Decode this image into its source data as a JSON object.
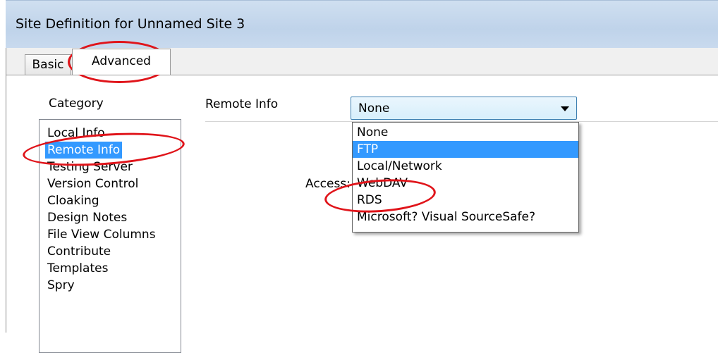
{
  "window": {
    "title": "Site Definition for Unnamed Site 3"
  },
  "tabs": [
    {
      "label": "Basic",
      "selected": false
    },
    {
      "label": "Advanced",
      "selected": true
    }
  ],
  "category": {
    "label": "Category",
    "items": [
      "Local Info",
      "Remote Info",
      "Testing Server",
      "Version Control",
      "Cloaking",
      "Design Notes",
      "File View Columns",
      "Contribute",
      "Templates",
      "Spry"
    ],
    "selected": "Remote Info"
  },
  "section": {
    "title": "Remote Info"
  },
  "access": {
    "label": "Access:",
    "value": "None",
    "options": [
      "None",
      "FTP",
      "Local/Network",
      "WebDAV",
      "RDS",
      "Microsoft? Visual SourceSafe?"
    ],
    "highlighted": "FTP"
  },
  "colors": {
    "selection": "#3399ff",
    "annotation": "#e0141a",
    "titlebar": "#c6d8ec"
  }
}
